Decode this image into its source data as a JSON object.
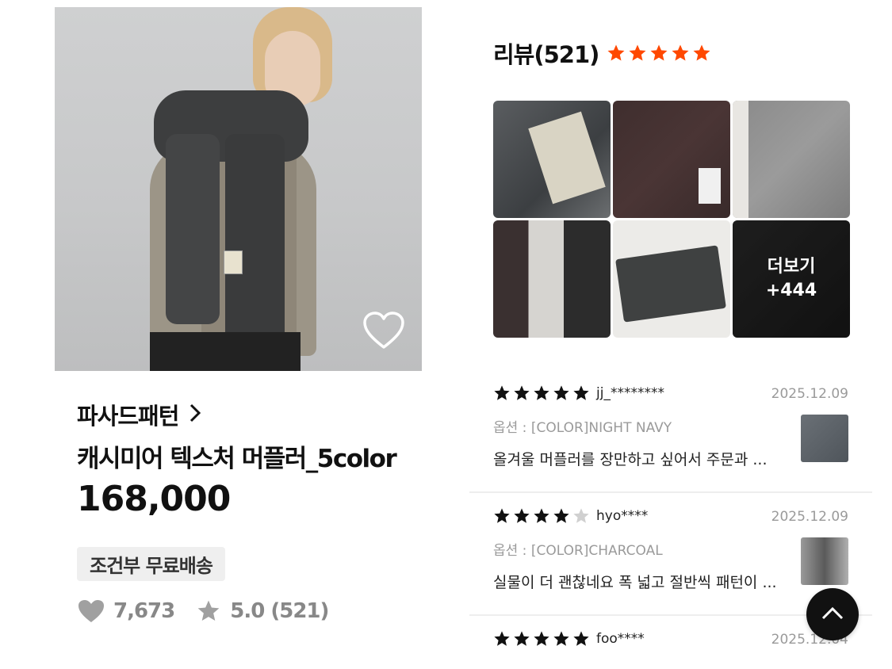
{
  "product": {
    "brand": "파사드패턴",
    "name": "캐시미어 텍스처 머플러_5color",
    "price": "168,000",
    "shipping_badge": "조건부 무료배송",
    "likes": "7,673",
    "rating": "5.0 (521)"
  },
  "reviews_section": {
    "title": "리뷰(521)",
    "rating_stars": 5,
    "star_color": "#ff4800",
    "more_label": "더보기",
    "more_count": "+444"
  },
  "reviews": [
    {
      "stars": 5,
      "user": "jj_********",
      "date": "2025.12.09",
      "option": "옵션 : [COLOR]NIGHT NAVY",
      "text": "올겨울 머플러를 장만하고 싶어서 주문과 ..."
    },
    {
      "stars": 4,
      "user": "hyo****",
      "date": "2025.12.09",
      "option": "옵션 : [COLOR]CHARCOAL",
      "text": "실물이 더 괜찮네요 폭 넓고 절반씩 패턴이 ..."
    },
    {
      "stars": 5,
      "user": "foo****",
      "date": "2025.12.04",
      "option": "",
      "text": ""
    }
  ]
}
